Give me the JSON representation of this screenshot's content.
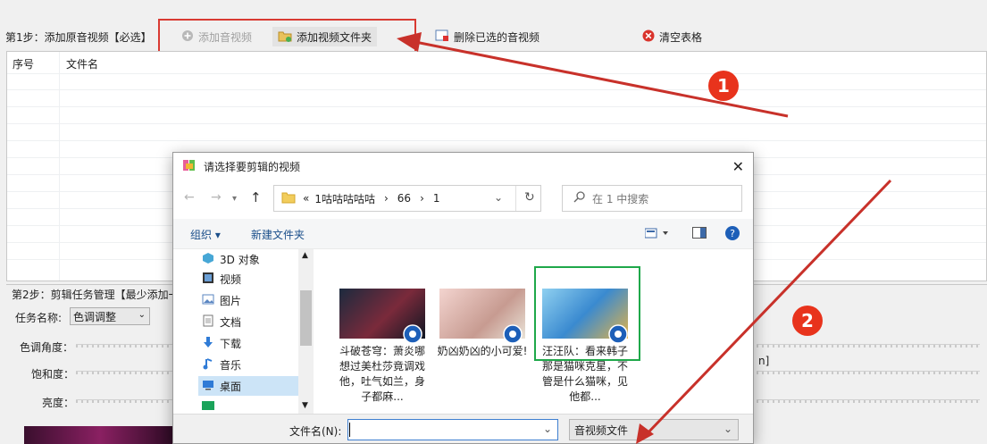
{
  "step1": {
    "label": "第1步：添加原音视频【必选】",
    "add_av": "添加音视频",
    "add_folder": "添加视频文件夹",
    "delete_selected": "删除已选的音视频",
    "clear_table": "清空表格"
  },
  "table": {
    "headers": [
      "序号",
      "文件名"
    ]
  },
  "step2": {
    "label": "第2步：剪辑任务管理【最少添加一",
    "task_name_label": "任务名称:",
    "task_name_value": "色调调整",
    "hue_label": "色调角度：",
    "saturation_label": "饱和度：",
    "brightness_label": "亮度：",
    "right_fragment": "n]"
  },
  "dialog": {
    "title": "请选择要剪辑的视频",
    "breadcrumb": [
      "«",
      "1咕咕咕咕咕",
      "66",
      "1"
    ],
    "search_placeholder": "在 1 中搜索",
    "organize": "组织 ▾",
    "new_folder": "新建文件夹",
    "nav_items": [
      "3D 对象",
      "视频",
      "图片",
      "文档",
      "下载",
      "音乐",
      "桌面"
    ],
    "files": [
      {
        "name": "斗破苍穹：萧炎哪想过美杜莎竟调戏他，吐气如兰，身子都麻..."
      },
      {
        "name": "奶凶奶凶的小可爱!"
      },
      {
        "name": "汪汪队：看来韩子那是猫咪克星，不管是什么猫咪，见他都..."
      }
    ],
    "filename_label": "文件名(N):",
    "filename_value": "",
    "filetype": "音视频文件"
  },
  "annotations": {
    "marker1": "1",
    "marker2": "2"
  },
  "colors": {
    "arrow": "#c8312a",
    "highlight_green": "#1fa84a",
    "marker_bg": "#e8331c"
  }
}
